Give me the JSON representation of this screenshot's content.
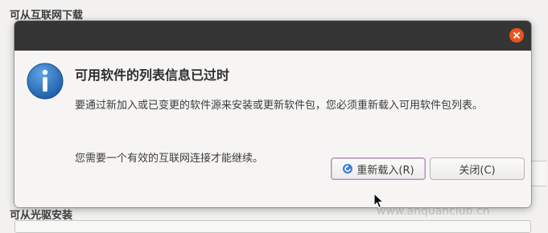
{
  "background": {
    "top_heading": "可从互联网下载",
    "bottom_heading": "可从光驱安装",
    "watermark": "www.anquanclub.cn"
  },
  "dialog": {
    "title": "可用软件的列表信息已过时",
    "message": "要通过新加入或已变更的软件源来安装或更新软件包，您必须重新载入可用软件包列表。",
    "note": "您需要一个有效的互联网连接才能继续。",
    "reload_button": "重新载入(R)",
    "close_button": "关闭(C)"
  },
  "icons": {
    "info": "info-icon",
    "refresh": "refresh-icon",
    "close": "close-icon"
  },
  "colors": {
    "titlebar": "#353535",
    "close_button": "#e95420",
    "info_icon": "#2f78c4"
  }
}
